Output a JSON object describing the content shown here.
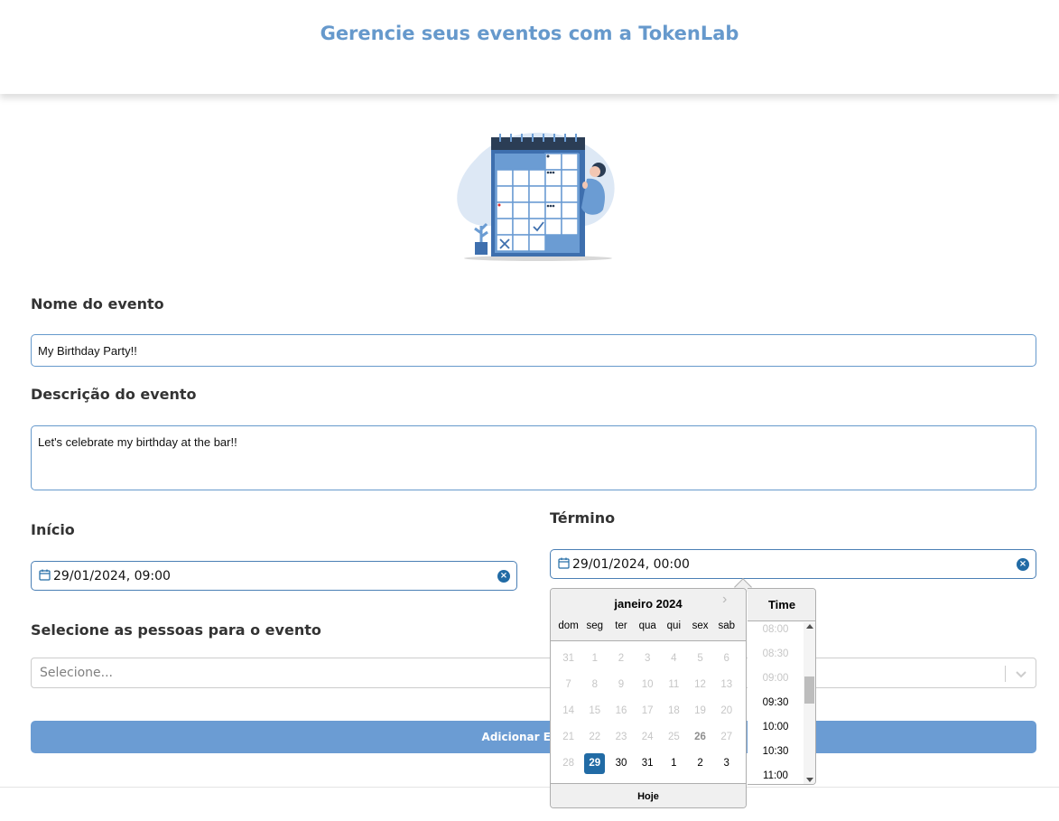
{
  "header": {
    "title": "Gerencie seus eventos com a TokenLab"
  },
  "form": {
    "name_label": "Nome do evento",
    "name_value": "My Birthday Party!!",
    "description_label": "Descrição do evento",
    "description_value": "Let's celebrate my birthday at the bar!!",
    "start_label": "Início",
    "start_value": "29/01/2024, 09:00",
    "end_label": "Término",
    "end_value": "29/01/2024, 00:00",
    "people_label": "Selecione as pessoas para o evento",
    "people_placeholder": "Selecione...",
    "submit_label": "Adicionar Evento",
    "clear_glyph": "×"
  },
  "datepicker": {
    "month_label": "janeiro 2024",
    "next_glyph": "›",
    "weekdays": [
      "dom",
      "seg",
      "ter",
      "qua",
      "qui",
      "sex",
      "sab"
    ],
    "weeks": [
      [
        "31",
        "1",
        "2",
        "3",
        "4",
        "5",
        "6"
      ],
      [
        "7",
        "8",
        "9",
        "10",
        "11",
        "12",
        "13"
      ],
      [
        "14",
        "15",
        "16",
        "17",
        "18",
        "19",
        "20"
      ],
      [
        "21",
        "22",
        "23",
        "24",
        "25",
        "26",
        "27"
      ],
      [
        "28",
        "29",
        "30",
        "31",
        "1",
        "2",
        "3"
      ]
    ],
    "selected_day": "29",
    "today_button": "Hoje",
    "time_title": "Time",
    "times": [
      "08:00",
      "08:30",
      "09:00",
      "09:30",
      "10:00",
      "10:30",
      "11:00"
    ],
    "disabled_times": 3
  },
  "colors": {
    "accent": "#6699cc",
    "primary_dark": "#216ba5",
    "submit": "#6b9cd3"
  }
}
